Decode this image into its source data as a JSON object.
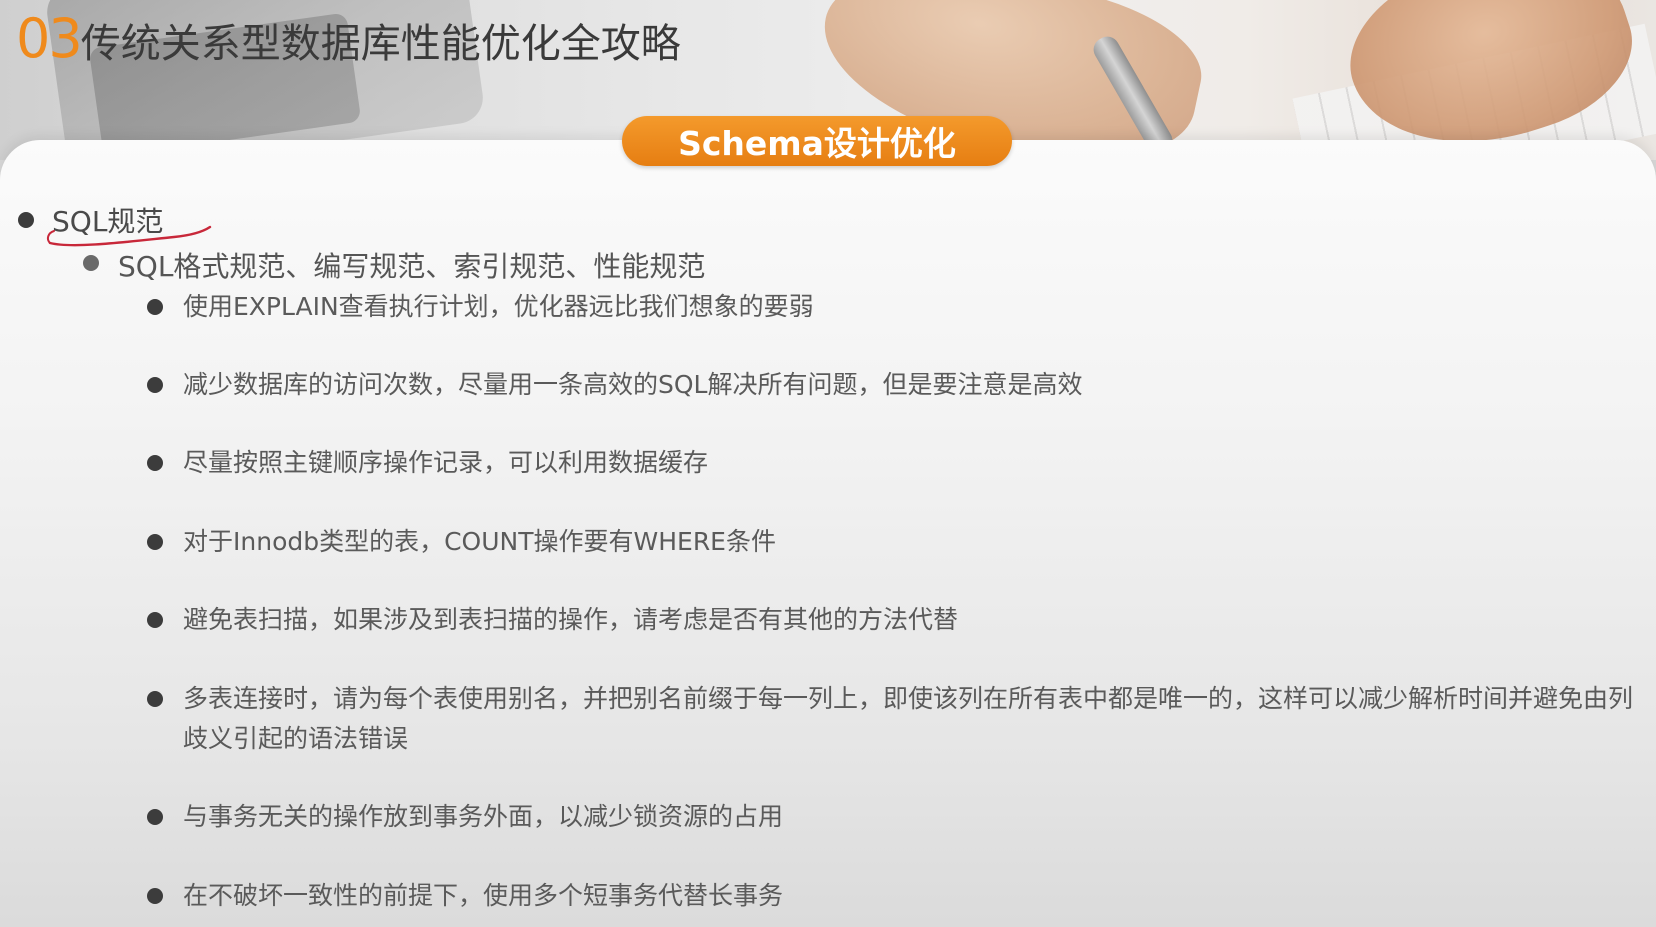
{
  "header": {
    "number": "03",
    "title": "传统关系型数据库性能优化全攻略"
  },
  "badge": {
    "label": "Schema设计优化"
  },
  "level1": {
    "label": "SQL规范"
  },
  "level2": {
    "label": "SQL格式规范、编写规范、索引规范、性能规范"
  },
  "items": [
    "使用EXPLAIN查看执行计划，优化器远比我们想象的要弱",
    "减少数据库的访问次数，尽量用一条高效的SQL解决所有问题，但是要注意是高效",
    "尽量按照主键顺序操作记录，可以利用数据缓存",
    "对于Innodb类型的表，COUNT操作要有WHERE条件",
    "避免表扫描，如果涉及到表扫描的操作，请考虑是否有其他的方法代替",
    "多表连接时，请为每个表使用别名，并把别名前缀于每一列上，即使该列在所有表中都是唯一的，这样可以减少解析时间并避免由列歧义引起的语法错误",
    "与事务无关的操作放到事务外面，以减少锁资源的占用",
    "在不破坏一致性的前提下，使用多个短事务代替长事务"
  ],
  "colors": {
    "accent": "#ef8a1c",
    "badge": "#e67e12",
    "annotation": "#c8283a"
  }
}
